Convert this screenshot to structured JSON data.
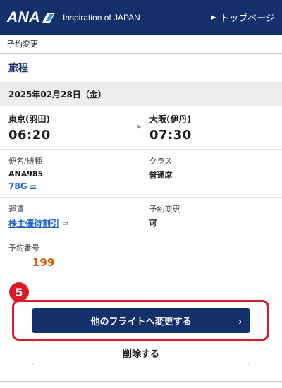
{
  "header": {
    "logo_text": "ANA",
    "tagline": "Inspiration of JAPAN",
    "top_link": "トップページ"
  },
  "breadcrumb": "予約変更",
  "itinerary": {
    "title": "旅程",
    "date": "2025年02月28日（金）",
    "departure": {
      "airport": "東京(羽田)",
      "time": "06:20"
    },
    "arrival": {
      "airport": "大阪(伊丹)",
      "time": "07:30"
    },
    "flight_label": "便名/機種",
    "flight_number": "ANA985",
    "aircraft": "78G",
    "class_label": "クラス",
    "class_value": "普通席",
    "fare_label": "運賃",
    "fare_value": "株主優待割引",
    "change_label": "予約変更",
    "change_value": "可",
    "reservation_label": "予約番号",
    "reservation_value": "199"
  },
  "step_number": "5",
  "buttons": {
    "change_flight": "他のフライトへ変更する",
    "delete": "削除する"
  },
  "colors": {
    "brand_navy": "#13306b",
    "highlight_red": "#d91c25",
    "link_blue": "#1f62c7",
    "reservation_orange": "#d65a00"
  }
}
